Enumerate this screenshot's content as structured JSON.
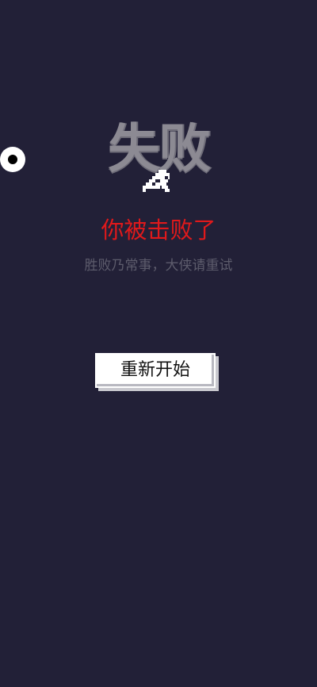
{
  "game_over": {
    "pixel_title": "失败",
    "title": "你被击败了",
    "subtitle": "胜败乃常事，大侠请重试",
    "restart_label": "重新开始"
  },
  "colors": {
    "background": "#222037",
    "title_red": "#e0191b",
    "subtitle_gray": "#5d5c6c",
    "pixel_gray": "#8c8a93"
  },
  "icons": {
    "side_eye": "eye-icon",
    "sprite": "fallen-hero-sprite-icon"
  }
}
